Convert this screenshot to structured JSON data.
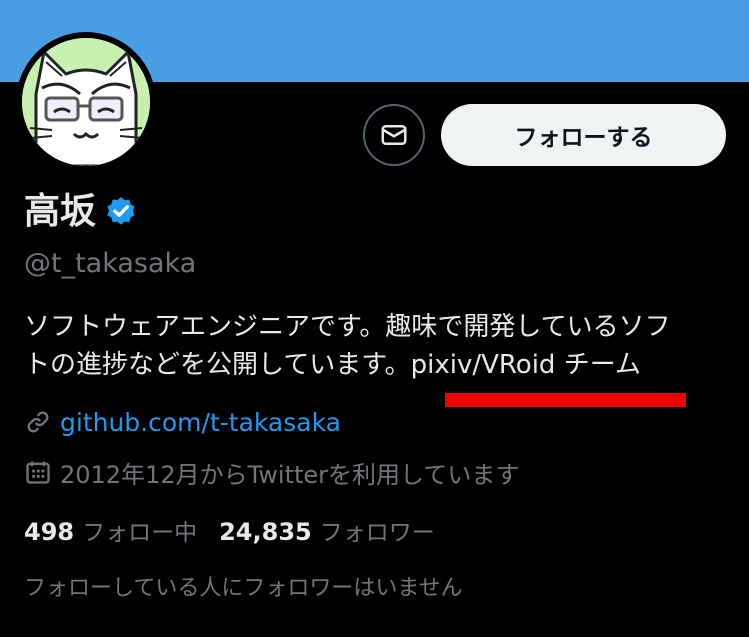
{
  "profile": {
    "name": "高坂",
    "handle": "@t_takasaka",
    "bio_line1": "ソフトウェアエンジニアです。趣味で開発しているソフ",
    "bio_line2": "トの進捗などを公開しています。pixiv/VRoid チーム",
    "link": "github.com/t-takasaka",
    "joined": "2012年12月からTwitterを利用しています"
  },
  "actions": {
    "message_icon": "envelope-icon",
    "follow_label": "フォローする"
  },
  "stats": {
    "following_count": "498",
    "following_label": "フォロー中",
    "followers_count": "24,835",
    "followers_label": "フォロワー"
  },
  "followers_you_know": "フォローしている人にフォロワーはいません",
  "colors": {
    "banner": "#4a9fe4",
    "background": "#000000",
    "accent": "#1d9bf0",
    "annotation_underline": "#ee0000"
  }
}
